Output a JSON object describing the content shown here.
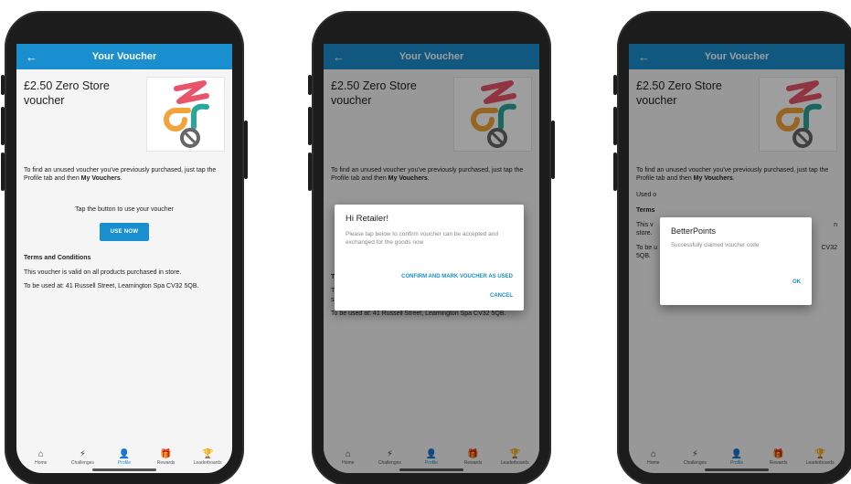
{
  "screens": [
    {
      "appbar": {
        "back_glyph": "←",
        "title": "Your Voucher"
      },
      "voucher_title": "£2.50 Zero Store voucher",
      "instructions": {
        "prefix": "To find an unused voucher you've previously purchased, just tap the Profile tab and then ",
        "bold": "My Vouchers",
        "suffix": "."
      },
      "cta_text": "Tap the button to use your voucher",
      "use_button": "USE NOW",
      "terms_heading": "Terms and Conditions",
      "terms_valid": "This voucher is valid on all products purchased in store.",
      "terms_location": "To be used at: 41 Russell Street, Leamington Spa CV32 5QB."
    },
    {
      "appbar": {
        "back_glyph": "←",
        "title": "Your Voucher"
      },
      "voucher_title": "£2.50 Zero Store voucher",
      "instructions": {
        "prefix": "To find an unused voucher you've previously purchased, just tap the Profile tab and then ",
        "bold": "My Vouchers",
        "suffix": "."
      },
      "terms_heading_partial": "T",
      "terms_valid_partial_1": "T",
      "terms_valid_partial_2": "s",
      "terms_location": "To be used at: 41 Russell Street, Leamington Spa CV32 5QB.",
      "dialog": {
        "title": "Hi Retailer!",
        "body": "Please tap below to confirm voucher can be accepted and exchanged for the goods now",
        "confirm": "CONFIRM AND MARK VOUCHER AS USED",
        "cancel": "CANCEL"
      }
    },
    {
      "appbar": {
        "back_glyph": "←",
        "title": "Your Voucher"
      },
      "voucher_title": "£2.50 Zero Store voucher",
      "instructions": {
        "prefix": "To find an unused voucher you've previously purchased, just tap the Profile tab and then ",
        "bold": "My Vouchers",
        "suffix": "."
      },
      "used_on_partial": "Used o",
      "terms_heading_partial": "Terms",
      "terms_valid_partial_1": "This v",
      "terms_valid_partial_2": "store.",
      "terms_valid_tail": "n",
      "terms_location_partial": "To be u",
      "terms_location_tail": "CV32",
      "postcode": "5QB.",
      "dialog": {
        "title": "BetterPoints",
        "body": "Successfully claimed voucher code",
        "ok": "OK"
      }
    }
  ],
  "tabs": [
    {
      "label": "Home",
      "icon": "home-icon",
      "glyph": "⌂"
    },
    {
      "label": "Challenges",
      "icon": "lightning-icon",
      "glyph": "⚡"
    },
    {
      "label": "Profile",
      "icon": "person-icon",
      "glyph": "👤",
      "active": true
    },
    {
      "label": "Rewards",
      "icon": "gift-icon",
      "glyph": "🎁"
    },
    {
      "label": "Leaderboards",
      "icon": "trophy-icon",
      "glyph": "🏆"
    }
  ],
  "colors": {
    "primary": "#1a8fcf",
    "logo_red": "#e8556b",
    "logo_orange": "#f2a33a",
    "logo_teal": "#2aa79b",
    "logo_grey": "#666666"
  }
}
